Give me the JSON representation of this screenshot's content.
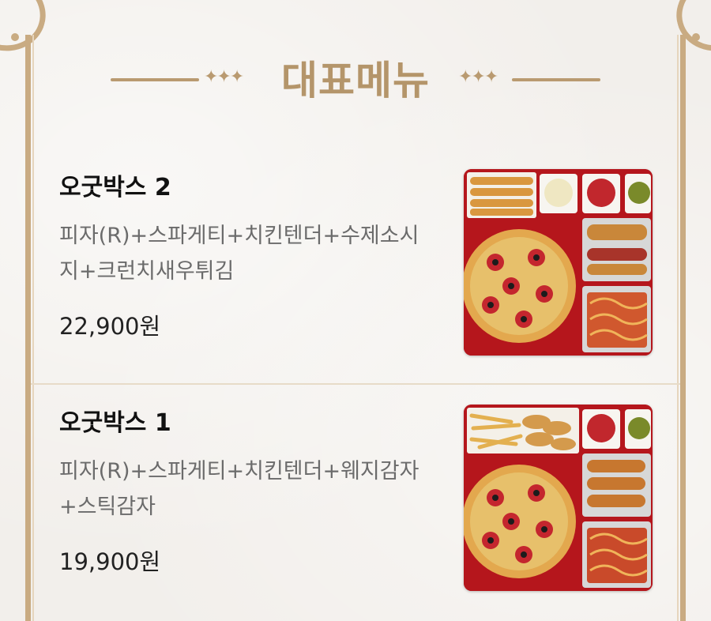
{
  "section": {
    "title": "대표메뉴"
  },
  "menu_items": [
    {
      "name": "오굿박스 2",
      "description": "피자(R)+스파게티+치킨텐더+수제소시지+크런치새우튀김",
      "price": "22,900원",
      "image_icon": "combo-box-2-photo"
    },
    {
      "name": "오굿박스 1",
      "description": "피자(R)+스파게티+치킨텐더+웨지감자+스틱감자",
      "price": "19,900원",
      "image_icon": "combo-box-1-photo"
    }
  ],
  "colors": {
    "accent_gold": "#b4956a",
    "frame": "#c9ab82",
    "tray_red": "#b5161c"
  }
}
